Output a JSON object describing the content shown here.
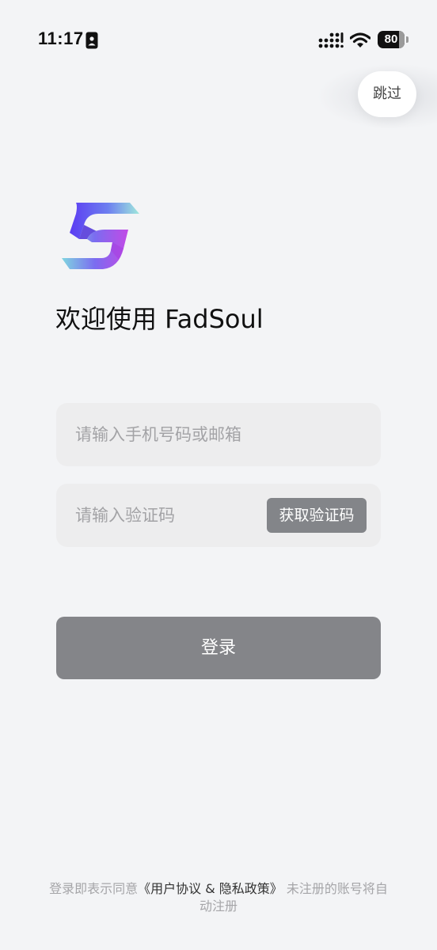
{
  "status_bar": {
    "time": "11:17",
    "battery": "80",
    "battery_fraction": 0.8
  },
  "header": {
    "skip_label": "跳过"
  },
  "brand": {
    "welcome_text": "欢迎使用 FadSoul",
    "logo_colors": [
      "#6a5af9",
      "#7fd0e0",
      "#b64ae0"
    ]
  },
  "form": {
    "phone_placeholder": "请输入手机号码或邮箱",
    "code_placeholder": "请输入验证码",
    "get_code_label": "获取验证码",
    "login_label": "登录"
  },
  "agreement": {
    "prefix": "登录即表示同意",
    "link": "《用户协议 & 隐私政策》",
    "suffix": "未注册的账号将自动注册"
  },
  "colors": {
    "background": "#f3f4f6",
    "field_background": "#ededee",
    "button_gray": "#848589"
  },
  "icons": [
    "id-card-icon",
    "cellular-signal-icon",
    "wifi-icon",
    "battery-icon",
    "fadsoul-logo"
  ]
}
